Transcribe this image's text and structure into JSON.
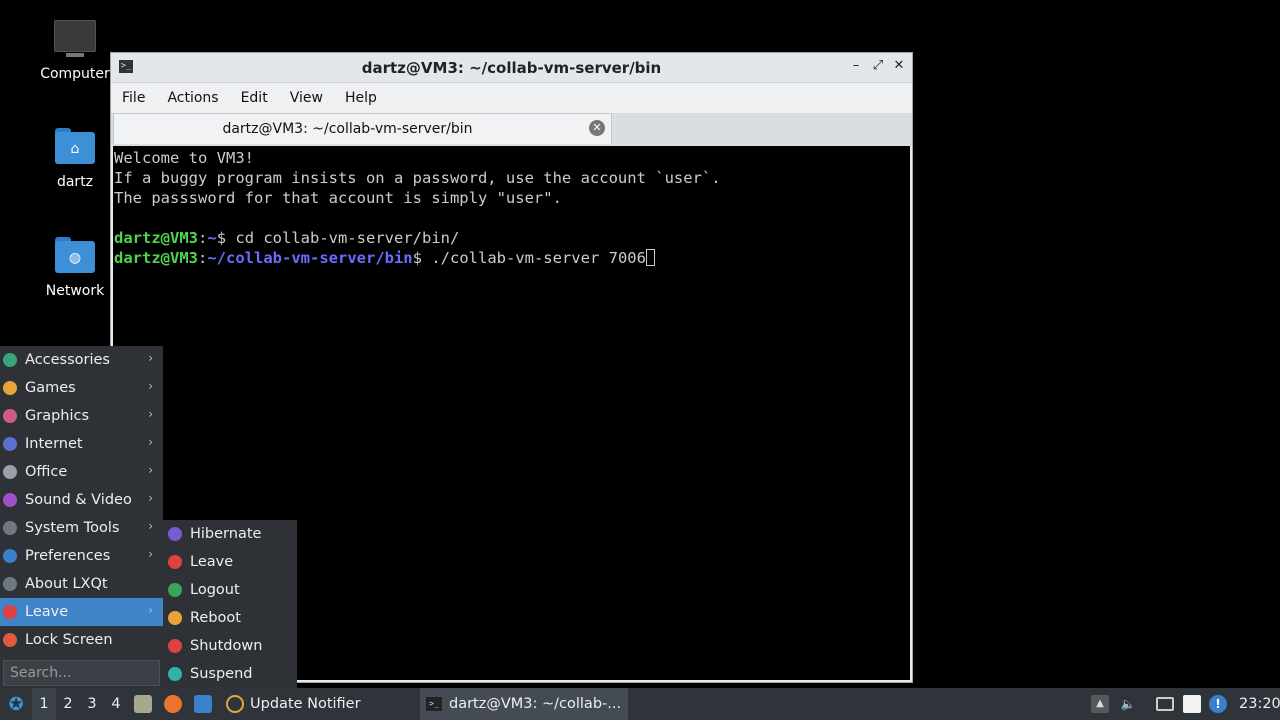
{
  "desktop": {
    "icons": [
      {
        "label": "Computer",
        "icon": "computer-icon"
      },
      {
        "label": "dartz",
        "icon": "home-folder-icon"
      },
      {
        "label": "Network",
        "icon": "network-folder-icon"
      }
    ]
  },
  "terminal": {
    "window_title": "dartz@VM3: ~/collab-vm-server/bin",
    "menu": [
      "File",
      "Actions",
      "Edit",
      "View",
      "Help"
    ],
    "tab_label": "dartz@VM3: ~/collab-vm-server/bin",
    "lines": [
      "Welcome to VM3!",
      "If a buggy program insists on a password, use the account `user`.",
      "The passsword for that account is simply \"user\"."
    ],
    "prompt1": {
      "user": "dartz@VM3",
      "sep": ":",
      "path": "~",
      "sym": "$ ",
      "cmd": "cd collab-vm-server/bin/"
    },
    "prompt2": {
      "user": "dartz@VM3",
      "sep": ":",
      "path": "~/collab-vm-server/bin",
      "sym": "$ ",
      "cmd": "./collab-vm-server 7006"
    }
  },
  "start_menu": {
    "items": [
      {
        "label": "Accessories",
        "icon": "accessories-icon",
        "color": "#3aa57a",
        "submenu": true
      },
      {
        "label": "Games",
        "icon": "games-icon",
        "color": "#e8a33a",
        "submenu": true
      },
      {
        "label": "Graphics",
        "icon": "graphics-icon",
        "color": "#d05a8a",
        "submenu": true
      },
      {
        "label": "Internet",
        "icon": "internet-icon",
        "color": "#5a6fd0",
        "submenu": true
      },
      {
        "label": "Office",
        "icon": "office-icon",
        "color": "#9aa0a6",
        "submenu": true
      },
      {
        "label": "Sound & Video",
        "icon": "sound-video-icon",
        "color": "#a050c8",
        "submenu": true
      },
      {
        "label": "System Tools",
        "icon": "system-tools-icon",
        "color": "#6f7780",
        "submenu": true
      },
      {
        "label": "Preferences",
        "icon": "preferences-icon",
        "color": "#3a7fc8",
        "submenu": true
      },
      {
        "label": "About LXQt",
        "icon": "info-icon",
        "color": "#6f7780",
        "submenu": false
      },
      {
        "label": "Leave",
        "icon": "power-icon",
        "color": "#e04040",
        "submenu": true
      },
      {
        "label": "Lock Screen",
        "icon": "lock-icon",
        "color": "#e05a40",
        "submenu": false
      }
    ],
    "search_placeholder": "Search..."
  },
  "leave_submenu": {
    "items": [
      {
        "label": "Hibernate",
        "icon": "hibernate-icon",
        "color": "#7a5ad0"
      },
      {
        "label": "Leave",
        "icon": "power-icon",
        "color": "#e04040"
      },
      {
        "label": "Logout",
        "icon": "logout-icon",
        "color": "#3aa55a"
      },
      {
        "label": "Reboot",
        "icon": "reboot-icon",
        "color": "#e8a33a"
      },
      {
        "label": "Shutdown",
        "icon": "shutdown-icon",
        "color": "#e04040"
      },
      {
        "label": "Suspend",
        "icon": "suspend-icon",
        "color": "#2fb4a8"
      }
    ]
  },
  "taskbar": {
    "desktops": [
      "1",
      "2",
      "3",
      "4"
    ],
    "update_notifier_label": "Update Notifier",
    "task_label": "dartz@VM3: ~/collab-...",
    "clock": "23:20"
  }
}
